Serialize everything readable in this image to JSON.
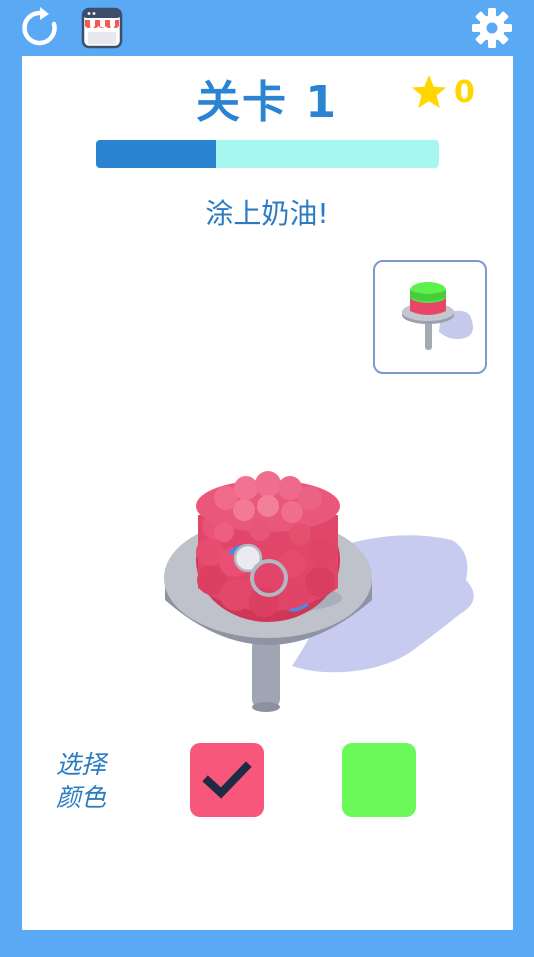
{
  "header": {
    "level_title": "关卡 1",
    "star_count": "0",
    "icons": [
      "restart-icon",
      "shop-icon",
      "settings-icon",
      "star-icon"
    ]
  },
  "progress": {
    "value": 0.35
  },
  "instruction": "涂上奶油!",
  "color_picker": {
    "label": "选择\n颜色",
    "options": [
      {
        "color": "#f7577a",
        "selected": true
      },
      {
        "color": "#6bf95a",
        "selected": false
      }
    ]
  },
  "colors": {
    "background": "#5aa9f5",
    "accent": "#2a84d2",
    "progress_track": "#a6f7ef",
    "cream": "#e84666",
    "star": "#ffd600"
  }
}
